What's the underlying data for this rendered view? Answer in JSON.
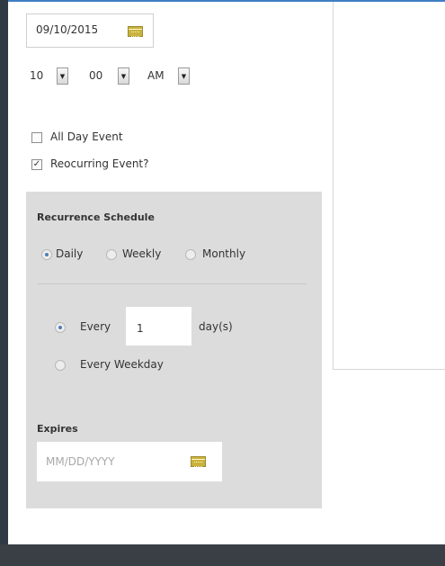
{
  "colors": {
    "accent": "#3f7fc4",
    "panel_bg": "#dcdcdc",
    "calendar_icon": "#c9b23d"
  },
  "start": {
    "date_value": "09/10/2015",
    "hour": "10",
    "minute": "00",
    "ampm": "AM"
  },
  "options": {
    "all_day_label": "All Day Event",
    "all_day_checked": false,
    "recurring_label": "Reocurring Event?",
    "recurring_checked": true
  },
  "recurrence": {
    "heading": "Recurrence Schedule",
    "frequencies": [
      {
        "label": "Daily",
        "selected": true
      },
      {
        "label": "Weekly",
        "selected": false
      },
      {
        "label": "Monthly",
        "selected": false
      }
    ],
    "every_label": "Every",
    "every_value": "1",
    "every_unit": "day(s)",
    "every_weekday_label": "Every Weekday",
    "expires_heading": "Expires",
    "expires_placeholder": "MM/DD/YYYY"
  },
  "icons": [
    "calendar-icon",
    "chevron-down-icon",
    "checkbox-icon",
    "radio-icon"
  ]
}
